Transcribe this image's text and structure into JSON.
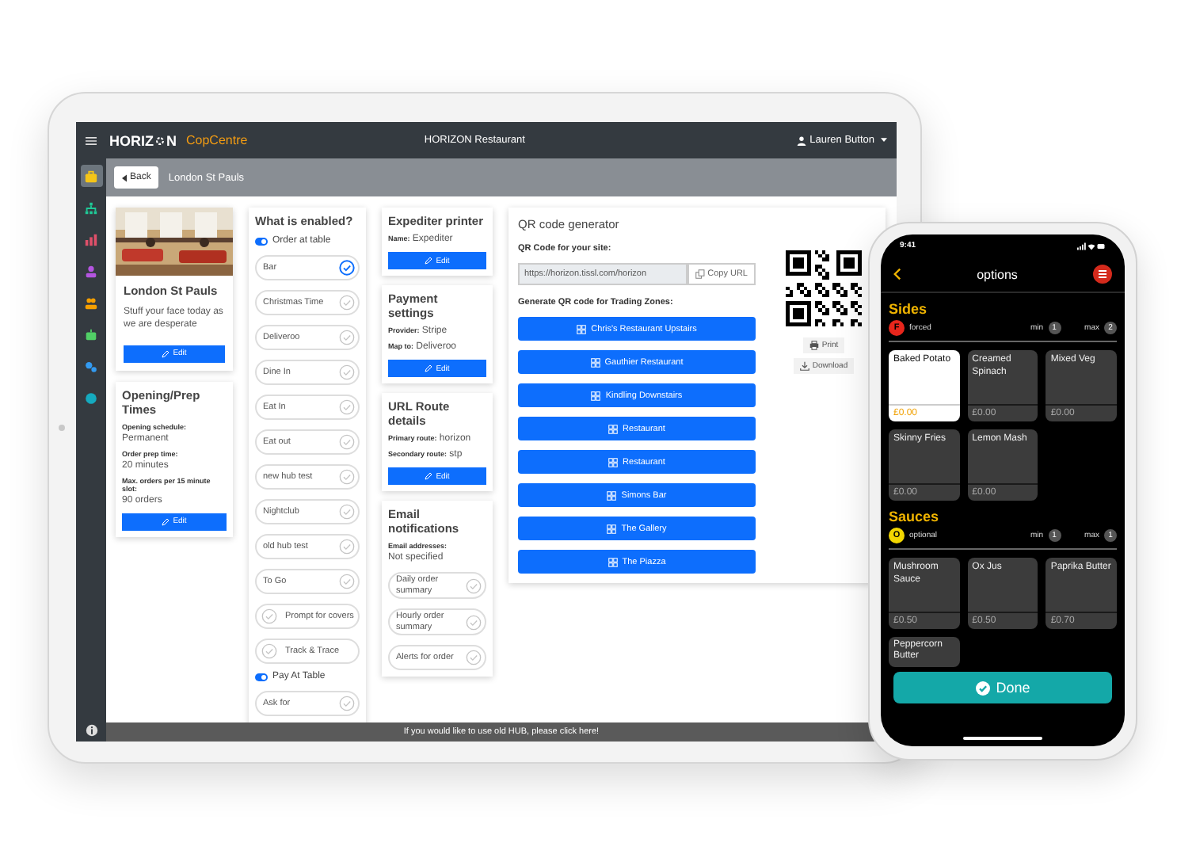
{
  "tablet": {
    "navbar": {
      "logo_left": "HORIZ",
      "logo_right": "N",
      "product": "CopCentre",
      "title": "HORIZON Restaurant",
      "user": "Lauren Button"
    },
    "sidebar": {
      "items": [
        {
          "kind": "briefcase",
          "color": "#f5c518",
          "selected": true
        },
        {
          "kind": "sitemap",
          "color": "#20c997",
          "selected": false
        },
        {
          "kind": "chart",
          "color": "#e0506a",
          "selected": false
        },
        {
          "kind": "person",
          "color": "#b455e0",
          "selected": false
        },
        {
          "kind": "people",
          "color": "#f59f00",
          "selected": false
        },
        {
          "kind": "robot",
          "color": "#51cf66",
          "selected": false
        },
        {
          "kind": "gears",
          "color": "#339af0",
          "selected": false
        },
        {
          "kind": "globe",
          "color": "#15aabf",
          "selected": false
        }
      ]
    },
    "breadcrumb": {
      "back": "Back",
      "title": "London St Pauls"
    },
    "site_card": {
      "kind": "picture",
      "name": "London St Pauls",
      "description": "Stuff your face today as we are desperate",
      "button": "Edit"
    },
    "times_card": {
      "title": "Opening/Prep Times",
      "fields": [
        {
          "kind": "stacked",
          "label": "Opening schedule:",
          "value": "Permanent"
        },
        {
          "kind": "stacked",
          "label": "Order prep time:",
          "value": "20 minutes"
        },
        {
          "kind": "stacked",
          "label": "Max. orders per 15 minute slot:",
          "value": "90 orders"
        }
      ],
      "button": "Edit"
    },
    "enabled_card": {
      "title": "What is enabled?",
      "groups": [
        {
          "label": "Order at table",
          "on": true,
          "items": [
            {
              "label": "Bar",
              "kind": "trailing",
              "selected": true
            },
            {
              "label": "Christmas Time",
              "kind": "trailing",
              "selected": false
            },
            {
              "label": "Deliveroo",
              "kind": "trailing",
              "selected": false
            },
            {
              "label": "Dine In",
              "kind": "trailing",
              "selected": false
            },
            {
              "label": "Eat In",
              "kind": "trailing",
              "selected": false
            },
            {
              "label": "Eat out",
              "kind": "trailing",
              "selected": false
            },
            {
              "label": "new hub test",
              "kind": "trailing",
              "selected": false
            },
            {
              "label": "Nightclub",
              "kind": "trailing",
              "selected": false
            },
            {
              "label": "old hub test",
              "kind": "trailing",
              "selected": false
            },
            {
              "label": "To Go",
              "kind": "trailing",
              "selected": false
            },
            {
              "label": "Prompt for covers",
              "kind": "leading",
              "selected": false
            },
            {
              "label": "Track & Trace",
              "kind": "leading",
              "selected": false
            }
          ]
        },
        {
          "label": "Pay At Table",
          "on": true,
          "items": [
            {
              "label": "Ask for",
              "kind": "trailing",
              "selected": false
            }
          ]
        }
      ]
    },
    "side_cards": [
      {
        "title": "Expediter printer",
        "fields": [
          {
            "kind": "inline",
            "label": "Name:",
            "value": "Expediter"
          }
        ],
        "button": "Edit"
      },
      {
        "title": "Payment settings",
        "fields": [
          {
            "kind": "inline",
            "label": "Provider:",
            "value": "Stripe"
          },
          {
            "kind": "inline",
            "label": "Map to:",
            "value": "Deliveroo"
          }
        ],
        "button": "Edit"
      },
      {
        "title": "URL Route details",
        "fields": [
          {
            "kind": "inline",
            "label": "Primary route:",
            "value": "horizon"
          },
          {
            "kind": "inline",
            "label": "Secondary route:",
            "value": "stp"
          }
        ],
        "button": "Edit"
      },
      {
        "title": "Email notifications",
        "fields": [
          {
            "kind": "stacked",
            "label": "Email addresses:",
            "value": "Not specified"
          }
        ],
        "items": [
          {
            "label": "Daily order summary",
            "selected": false
          },
          {
            "label": "Hourly order summary",
            "selected": false
          },
          {
            "label": "Alerts for order",
            "selected": false
          }
        ]
      }
    ],
    "qr_card": {
      "title": "QR code generator",
      "site_label": "QR Code for your site:",
      "url": "https://horizon.tissl.com/horizon",
      "copy": "Copy URL",
      "zones_label": "Generate QR code for Trading Zones:",
      "zones": [
        "Chris's Restaurant Upstairs",
        "Gauthier Restaurant",
        "Kindling Downstairs",
        "Restaurant",
        "Restaurant",
        "Simons Bar",
        "The Gallery",
        "The Piazza"
      ],
      "print": "Print",
      "download": "Download"
    },
    "footer": "If you would like to use old HUB, please click here!"
  },
  "phone": {
    "time": "9:41",
    "title": "options",
    "sections": [
      {
        "title": "Sides",
        "badge": "F",
        "color": "#e8261c",
        "rule": "forced",
        "min_label": "min",
        "min": "1",
        "max_label": "max",
        "max": "2",
        "options": [
          {
            "name": "Baked Potato",
            "price": "£0.00",
            "selected": true
          },
          {
            "name": "Creamed Spinach",
            "price": "£0.00",
            "selected": false
          },
          {
            "name": "Mixed Veg",
            "price": "£0.00",
            "selected": false
          },
          {
            "name": "Skinny Fries",
            "price": "£0.00",
            "selected": false
          },
          {
            "name": "Lemon Mash",
            "price": "£0.00",
            "selected": false
          }
        ]
      },
      {
        "title": "Sauces",
        "badge": "O",
        "color": "#f2d600",
        "rule": "optional",
        "min_label": "min",
        "min": "1",
        "max_label": "max",
        "max": "1",
        "options": [
          {
            "name": "Mushroom Sauce",
            "price": "£0.50",
            "selected": false
          },
          {
            "name": "Ox Jus",
            "price": "£0.50",
            "selected": false
          },
          {
            "name": "Paprika Butter",
            "price": "£0.70",
            "selected": false
          },
          {
            "name": "Peppercorn Butter",
            "selected": false
          }
        ]
      }
    ],
    "done": "Done"
  }
}
